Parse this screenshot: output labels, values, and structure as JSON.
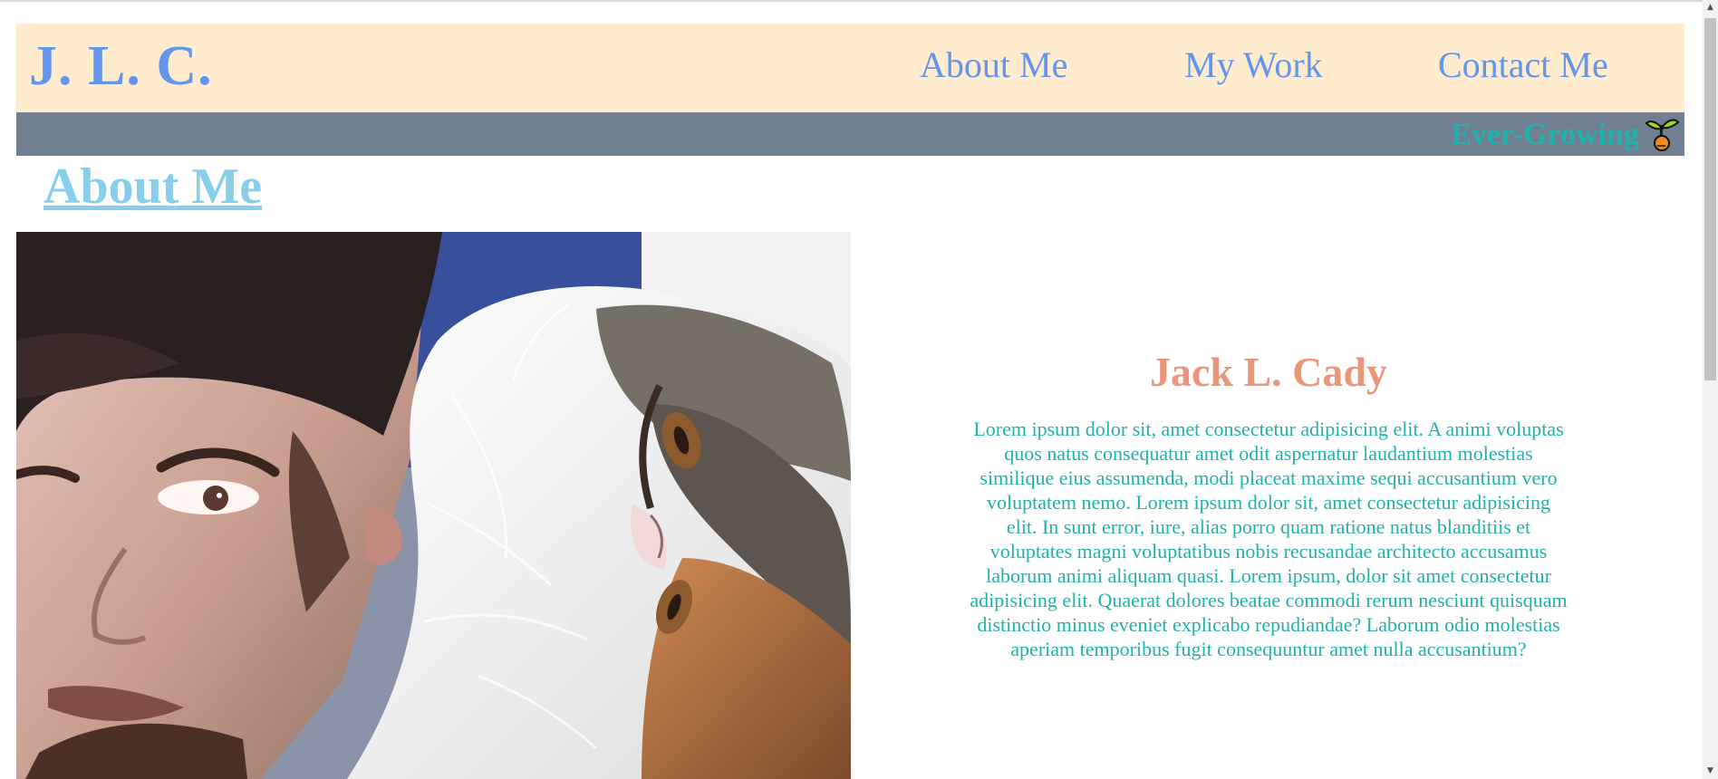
{
  "header": {
    "brand": "J. L. C.",
    "nav": [
      "About Me",
      "My Work",
      "Contact Me"
    ]
  },
  "subbar": {
    "tagline": "Ever-Growing",
    "icon": "sprout-icon"
  },
  "section": {
    "title": "About Me"
  },
  "bio": {
    "name": "Jack L. Cady",
    "text": "Lorem ipsum dolor sit, amet consectetur adipisicing elit. A animi voluptas quos natus consequatur amet odit aspernatur laudantium molestias similique eius assumenda, modi placeat maxime sequi accusantium vero voluptatem nemo. Lorem ipsum dolor sit, amet consectetur adipisicing elit. In sunt error, iure, alias porro quam ratione natus blanditiis et voluptates magni voluptatibus nobis recusandae architecto accusamus laborum animi aliquam quasi. Lorem ipsum, dolor sit amet consectetur adipisicing elit. Quaerat dolores beatae commodi rerum nesciunt quisquam distinctio minus eveniet explicabo repudiandae? Laborum odio molestias aperiam temporibus fugit consequuntur amet nulla accusantium?"
  },
  "colors": {
    "header_bg": "#FFEBCD",
    "nav_text": "#6495ED",
    "subbar_bg": "#708090",
    "tagline": "#20B2AA",
    "section_title": "#87CEEB",
    "bio_name": "#E9967A",
    "bio_text": "#20B2AA"
  }
}
